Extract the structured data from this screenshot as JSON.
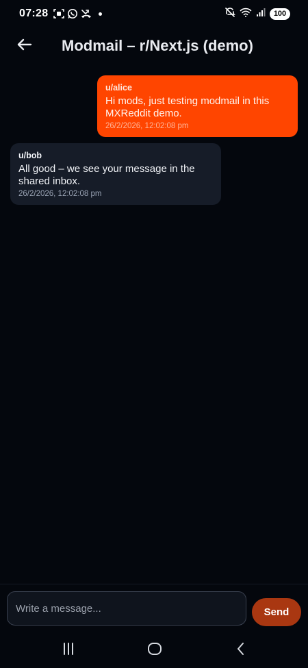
{
  "status_bar": {
    "time": "07:28",
    "battery": "100"
  },
  "header": {
    "title": "Modmail – r/Next.js (demo)"
  },
  "messages": [
    {
      "author": "u/alice",
      "text": "Hi mods, just testing modmail in this MXReddit demo.",
      "timestamp": "26/2/2026, 12:02:08 pm",
      "direction": "outgoing"
    },
    {
      "author": "u/bob",
      "text": "All good – we see your message in the shared inbox.",
      "timestamp": "26/2/2026, 12:02:08 pm",
      "direction": "incoming"
    }
  ],
  "composer": {
    "placeholder": "Write a message...",
    "value": "",
    "send_label": "Send"
  },
  "colors": {
    "accent": "#ff4500",
    "send_button": "#a93711",
    "incoming_bubble": "#161c28",
    "background": "#04070d"
  },
  "icons": {
    "back": "arrow-left-icon",
    "nav_recent": "recent-apps-icon",
    "nav_home": "home-icon",
    "nav_back": "chevron-left-icon"
  }
}
